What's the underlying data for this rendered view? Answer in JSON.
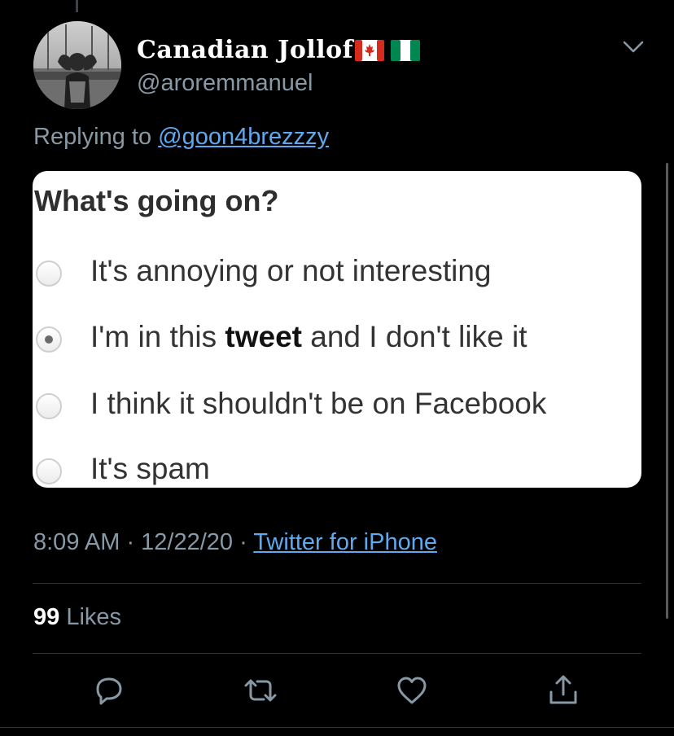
{
  "tweet": {
    "display_name": "Canadian Jollof",
    "flags": [
      "canada-flag",
      "nigeria-flag"
    ],
    "handle": "@aroremmanuel",
    "replying_prefix": "Replying to ",
    "replying_to": "@goon4brezzzy",
    "timestamp": "8:09 AM · 12/22/20 · ",
    "source": "Twitter for iPhone",
    "likes_count": "99",
    "likes_label": " Likes"
  },
  "embedded_image": {
    "title": "What's going on?",
    "options": [
      {
        "text": "It's annoying or not interesting",
        "selected": false
      },
      {
        "before": "I'm in this ",
        "bold": "tweet",
        "after": " and I don't like it",
        "selected": true
      },
      {
        "text": "I think it shouldn't be on Facebook",
        "selected": false
      },
      {
        "text": "It's spam",
        "selected": false
      }
    ]
  },
  "actions": [
    "reply-icon",
    "retweet-icon",
    "like-icon",
    "share-icon"
  ],
  "colors": {
    "background": "#000000",
    "secondary_text": "#8899a6",
    "link": "#5fa9ee",
    "divider": "#2f3336",
    "icon": "#8899a6"
  }
}
